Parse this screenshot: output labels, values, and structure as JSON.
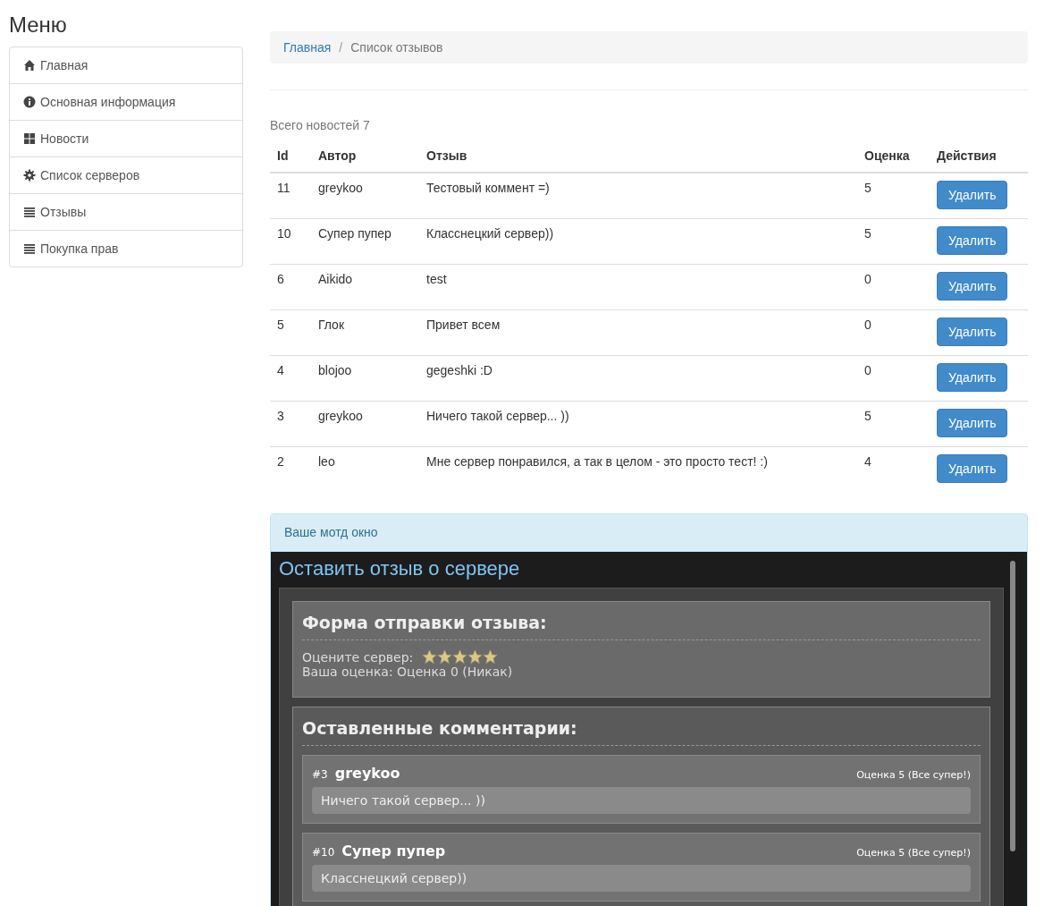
{
  "sidebar": {
    "title": "Меню",
    "items": [
      {
        "kind": "home",
        "label": "Главная"
      },
      {
        "kind": "info",
        "label": "Основная информация"
      },
      {
        "kind": "grid",
        "label": "Новости"
      },
      {
        "kind": "gear",
        "label": "Список серверов"
      },
      {
        "kind": "list",
        "label": "Отзывы"
      },
      {
        "kind": "list",
        "label": "Покупка прав"
      }
    ]
  },
  "breadcrumb": [
    {
      "label": "Главная",
      "kind": "link"
    },
    {
      "label": "Список отзывов",
      "kind": "current",
      "separator": "/"
    }
  ],
  "total": "Всего новостей 7",
  "table": {
    "columns": [
      "Id",
      "Автор",
      "Отзыв",
      "Оценка",
      "Действия"
    ],
    "rows": [
      {
        "id": "11",
        "author": "greykoo",
        "text": "Тестовый коммент =)",
        "rating": "5",
        "action": "Удалить"
      },
      {
        "id": "10",
        "author": "Супер пупер",
        "text": "Класснецкий сервер))",
        "rating": "5",
        "action": "Удалить"
      },
      {
        "id": "6",
        "author": "Aikido",
        "text": "test",
        "rating": "0",
        "action": "Удалить"
      },
      {
        "id": "5",
        "author": "Глок",
        "text": "Привет всем",
        "rating": "0",
        "action": "Удалить"
      },
      {
        "id": "4",
        "author": "blojoo",
        "text": "gegeshki :D",
        "rating": "0",
        "action": "Удалить"
      },
      {
        "id": "3",
        "author": "greykoo",
        "text": "Ничего такой сервер... ))",
        "rating": "5",
        "action": "Удалить"
      },
      {
        "id": "2",
        "author": "leo",
        "text": "Мне сервер понравился, а так в целом - это просто тест! :)",
        "rating": "4",
        "action": "Удалить"
      }
    ]
  },
  "motd": {
    "heading": "Ваше мотд окно",
    "title": "Оставить отзыв о сервере",
    "form": {
      "title": "Форма отправки отзыва:",
      "rate_label": "Оцените сервер:",
      "stars": 5,
      "your_rating": "Ваша оценка: Оценка 0 (Никак)"
    },
    "comments_title": "Оставленные комментарии:",
    "comments": [
      {
        "number": "#3",
        "author": "greykoo",
        "rating": "Оценка 5 (Все супер!)",
        "text": "Ничего такой сервер... ))"
      },
      {
        "number": "#10",
        "author": "Супер пупер",
        "rating": "Оценка 5 (Все супер!)",
        "text": "Класснецкий сервер))"
      }
    ]
  }
}
